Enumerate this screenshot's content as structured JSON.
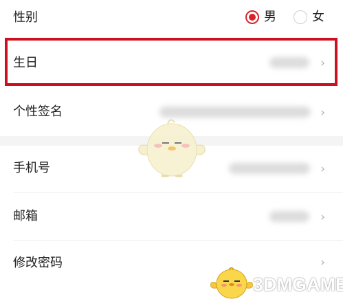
{
  "gender": {
    "label": "性别",
    "options": [
      {
        "label": "男",
        "selected": true
      },
      {
        "label": "女",
        "selected": false
      }
    ],
    "accent_color": "#d8232a"
  },
  "birthday": {
    "label": "生日",
    "chevron": "›"
  },
  "signature": {
    "label": "个性签名",
    "chevron": "›"
  },
  "phone": {
    "label": "手机号",
    "chevron": "›"
  },
  "email": {
    "label": "邮箱",
    "chevron": "›"
  },
  "change_password": {
    "label": "修改密码",
    "chevron": "›"
  },
  "highlight_color": "#cc1020",
  "watermark": {
    "text": "3DMGAME",
    "icon": "chick-mascot-icon"
  },
  "mascot_icon": "chick-mascot-icon"
}
